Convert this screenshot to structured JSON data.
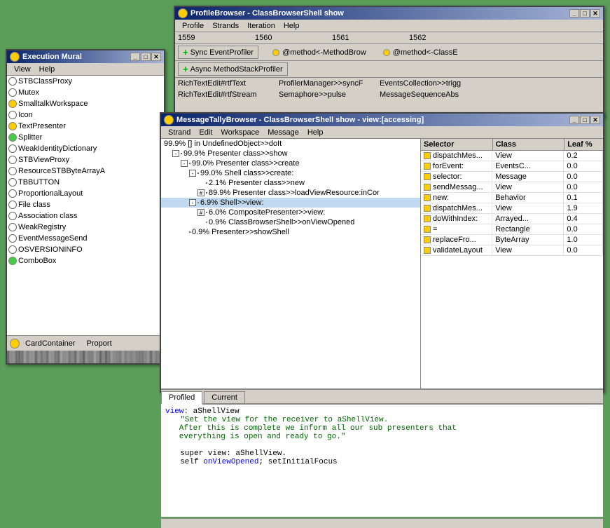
{
  "execMural": {
    "title": "Execution Mural",
    "menu": [
      "View",
      "Help"
    ],
    "items": [
      {
        "label": "STBClassProxy",
        "bulletClass": "bullet-empty"
      },
      {
        "label": "Mutex",
        "bulletClass": "bullet-empty"
      },
      {
        "label": "SmalltalkWorkspace",
        "bulletClass": "bullet-yellow"
      },
      {
        "label": "Icon",
        "bulletClass": "bullet-empty"
      },
      {
        "label": "TextPresenter",
        "bulletClass": "bullet-yellow"
      },
      {
        "label": "Splitter",
        "bulletClass": "bullet-v"
      },
      {
        "label": "WeakIdentityDictionary",
        "bulletClass": "bullet-empty"
      },
      {
        "label": "STBViewProxy",
        "bulletClass": "bullet-empty"
      },
      {
        "label": "ResourceSTBByteArrayA",
        "bulletClass": "bullet-empty"
      },
      {
        "label": "TBBUTTON",
        "bulletClass": "bullet-empty"
      },
      {
        "label": "ProportionalLayout",
        "bulletClass": "bullet-empty"
      },
      {
        "label": "File class",
        "bulletClass": "bullet-empty"
      },
      {
        "label": "Association class",
        "bulletClass": "bullet-empty"
      },
      {
        "label": "WeakRegistry",
        "bulletClass": "bullet-empty"
      },
      {
        "label": "EventMessageSend",
        "bulletClass": "bullet-empty"
      },
      {
        "label": "OSVERSIONINFO",
        "bulletClass": "bullet-empty"
      },
      {
        "label": "ComboBox",
        "bulletClass": "bullet-v"
      }
    ],
    "cardContainerLabel": "CardContainer",
    "proportLabel": "Proport"
  },
  "profileBrowser": {
    "title": "ProfileBrowser - ClassBrowserShell show",
    "menu": [
      "Profile",
      "Strands",
      "Iteration",
      "Help"
    ],
    "cols": [
      "1559",
      "1560",
      "1561",
      "1562"
    ],
    "syncBtn": "+ Sync EventProfiler",
    "asyncBtn": "+ Async MethodStackProfiler",
    "rows": [
      [
        "RichTextEdit#rtfText",
        "ProfilerManager>>syncF",
        "EventsCollection>>trigg"
      ],
      [
        "RichTextEdit#rtfStream",
        "Semaphore>>pulse",
        "MessageSequenceAbs"
      ]
    ],
    "methodBrow": "@method<-MethodBrow",
    "classE": "@method<-ClassE"
  },
  "msgTally": {
    "title": "MessageTallyBrowser - ClassBrowserShell show - view:[accessing]",
    "menu": [
      "Strand",
      "Edit",
      "Workspace",
      "Message",
      "Help"
    ],
    "treeItems": [
      {
        "label": "99.9% [] in UndefinedObject>>doIt",
        "indent": 0,
        "expand": null,
        "bullet": null
      },
      {
        "label": "99.9% Presenter class>>show",
        "indent": 1,
        "expand": "-",
        "bullet": "empty"
      },
      {
        "label": "99.0% Presenter class>>create",
        "indent": 2,
        "expand": "-",
        "bullet": "empty"
      },
      {
        "label": "99.0% Shell class>>create:",
        "indent": 3,
        "expand": "-",
        "bullet": "empty"
      },
      {
        "label": "2.1% Presenter class>>new",
        "indent": 4,
        "expand": null,
        "bullet": "empty"
      },
      {
        "label": "89.9% Presenter class>>loadViewResource:inCor",
        "indent": 4,
        "expand": "#",
        "bullet": "empty"
      },
      {
        "label": "6.9% Shell>>view:",
        "indent": 3,
        "expand": "-",
        "bullet": "green",
        "highlight": true
      },
      {
        "label": "6.0% CompositePresenter>>view:",
        "indent": 4,
        "expand": "#",
        "bullet": "empty"
      },
      {
        "label": "0.9% ClassBrowserShell>>onViewOpened",
        "indent": 4,
        "expand": null,
        "bullet": "yellow"
      },
      {
        "label": "0.9% Presenter>>showShell",
        "indent": 2,
        "expand": null,
        "bullet": "empty"
      }
    ],
    "tableHeaders": [
      "Selector",
      "Class",
      "Leaf %"
    ],
    "tableRows": [
      {
        "selector": "dispatchMes...",
        "class": "View",
        "leaf": "0.2"
      },
      {
        "selector": "forEvent:",
        "class": "EventsC...",
        "leaf": "0.0"
      },
      {
        "selector": "selector:",
        "class": "Message",
        "leaf": "0.0"
      },
      {
        "selector": "sendMessag...",
        "class": "View",
        "leaf": "0.0"
      },
      {
        "selector": "new:",
        "class": "Behavior",
        "leaf": "0.1"
      },
      {
        "selector": "dispatchMes...",
        "class": "View",
        "leaf": "1.9"
      },
      {
        "selector": "doWithIndex:",
        "class": "Arrayed...",
        "leaf": "0.4"
      },
      {
        "selector": "=",
        "class": "Rectangle",
        "leaf": "0.0"
      },
      {
        "selector": "replaceFro...",
        "class": "ByteArray",
        "leaf": "1.0"
      },
      {
        "selector": "validateLayout",
        "class": "View",
        "leaf": "0.0"
      }
    ],
    "tabs": [
      "Profiled",
      "Current"
    ],
    "activeTab": "Profiled",
    "codeContent": {
      "label": "view:",
      "varName": "aShellView",
      "comment": "\"Set the view for the receiver to aShellView.\n\tAfter this is complete we inform all our sub presenters that\n\teverything is open and ready to go.\"",
      "line1": "super view: aShellView.",
      "line2": "self onViewOpened; setInitialFocus"
    }
  }
}
